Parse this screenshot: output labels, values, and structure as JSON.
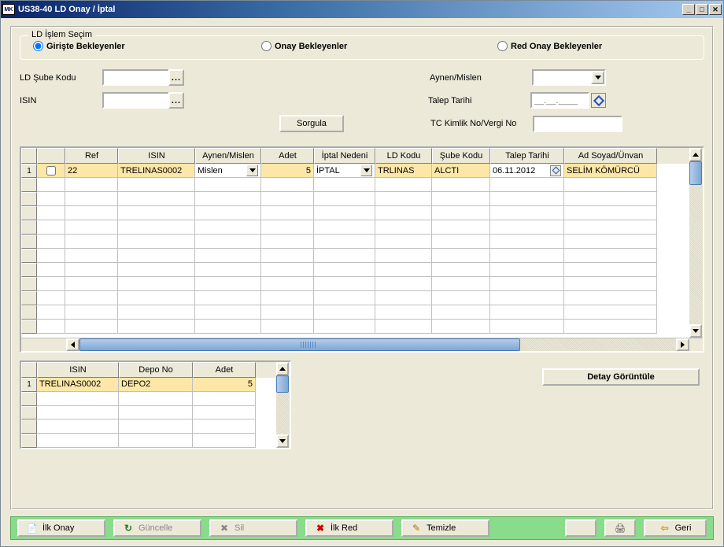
{
  "window": {
    "title": "US38-40 LD Onay / İptal"
  },
  "groupbox": {
    "title": "LD İşlem Seçim"
  },
  "radios": {
    "r1": "Girişte Bekleyenler",
    "r2": "Onay Bekleyenler",
    "r3": "Red Onay Bekleyenler",
    "selected": "r1"
  },
  "labels": {
    "ld_sube": "LD Şube Kodu",
    "isin": "ISIN",
    "aynen": "Aynen/Mislen",
    "talep_tarihi": "Talep Tarihi",
    "tc": "TC Kimlik No/Vergi No",
    "sorgula": "Sorgula",
    "date_placeholder": "__.__.____"
  },
  "grid": {
    "headers": {
      "chk": "",
      "ref": "Ref",
      "isin": "ISIN",
      "aynen": "Aynen/Mislen",
      "adet": "Adet",
      "iptal": "İptal Nedeni",
      "ldkodu": "LD Kodu",
      "sube": "Şube Kodu",
      "talep": "Talep Tarihi",
      "ad": "Ad Soyad/Ünvan"
    },
    "rows": [
      {
        "num": "1",
        "chk": false,
        "ref": "22",
        "isin": "TRELINAS0002",
        "aynen": "Mislen",
        "adet": "5",
        "iptal": "İPTAL",
        "ldkodu": "TRLINAS",
        "sube": "ALCTI",
        "talep": "06.11.2012",
        "ad": "SELİM KÖMÜRCÜ"
      }
    ]
  },
  "small_grid": {
    "headers": {
      "isin": "ISIN",
      "depo": "Depo No",
      "adet": "Adet"
    },
    "rows": [
      {
        "num": "1",
        "isin": "TRELINAS0002",
        "depo": "DEPO2",
        "adet": "5"
      }
    ]
  },
  "detail_btn": "Detay Görüntüle",
  "toolbar": {
    "ilk_onay": "İlk Onay",
    "guncelle": "Güncelle",
    "sil": "Sil",
    "ilk_red": "İlk Red",
    "temizle": "Temizle",
    "geri": "Geri"
  }
}
